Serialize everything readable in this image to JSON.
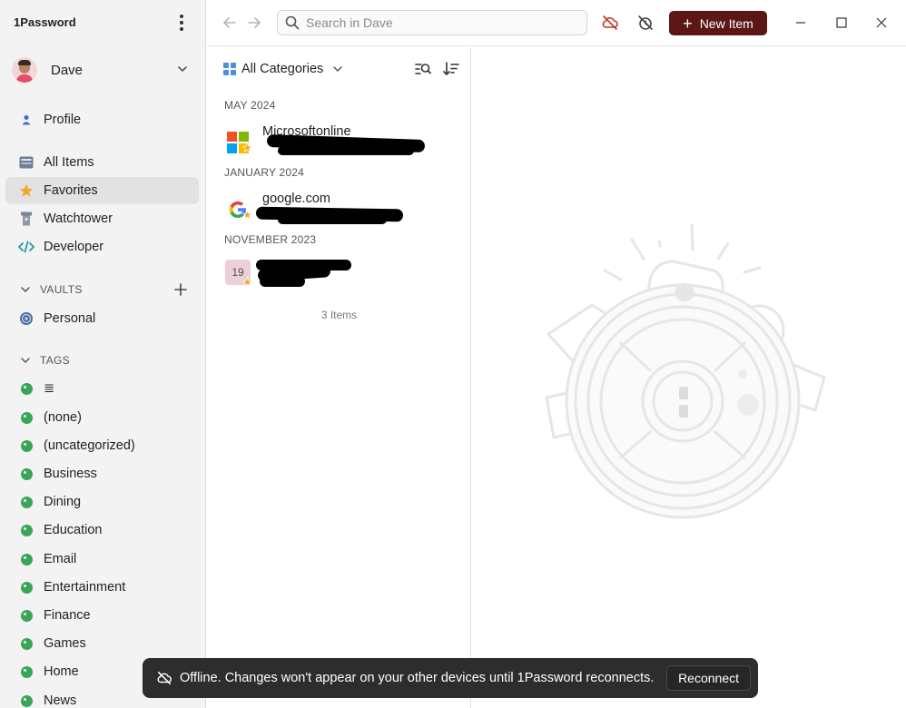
{
  "app": {
    "title": "1Password"
  },
  "account": {
    "name": "Dave"
  },
  "sidebar": {
    "profile_label": "Profile",
    "items": [
      {
        "label": "All Items",
        "icon": "all-items-icon"
      },
      {
        "label": "Favorites",
        "icon": "star-icon",
        "active": true
      },
      {
        "label": "Watchtower",
        "icon": "watchtower-icon"
      },
      {
        "label": "Developer",
        "icon": "code-icon"
      }
    ],
    "vaults_header": "VAULTS",
    "vaults": [
      {
        "label": "Personal",
        "icon": "vault-icon"
      }
    ],
    "tags_header": "TAGS",
    "tags": [
      {
        "label": "≣"
      },
      {
        "label": "(none)"
      },
      {
        "label": "(uncategorized)"
      },
      {
        "label": "Business"
      },
      {
        "label": "Dining"
      },
      {
        "label": "Education"
      },
      {
        "label": "Email"
      },
      {
        "label": "Entertainment"
      },
      {
        "label": "Finance"
      },
      {
        "label": "Games"
      },
      {
        "label": "Home"
      },
      {
        "label": "News"
      }
    ]
  },
  "search": {
    "placeholder": "Search in Dave",
    "value": ""
  },
  "toolbar": {
    "new_item_label": "New Item"
  },
  "list": {
    "category_label": "All Categories",
    "groups": [
      {
        "label": "MAY 2024",
        "item_title": "Microsoftonline",
        "icon": "microsoft-logo-icon"
      },
      {
        "label": "JANUARY 2024",
        "item_title": "google.com",
        "icon": "google-logo-icon"
      },
      {
        "label": "NOVEMBER 2023",
        "item_title": "",
        "badge": "19",
        "icon": "calendar-icon"
      }
    ],
    "count_label": "3 Items"
  },
  "toast": {
    "message": "Offline. Changes won't appear on your other devices until 1Password reconnects.",
    "action_label": "Reconnect"
  },
  "colors": {
    "accent": "#5c1616",
    "tag": "#3aa557",
    "favorite": "#f5a623",
    "selected": "#e3e1e1"
  }
}
